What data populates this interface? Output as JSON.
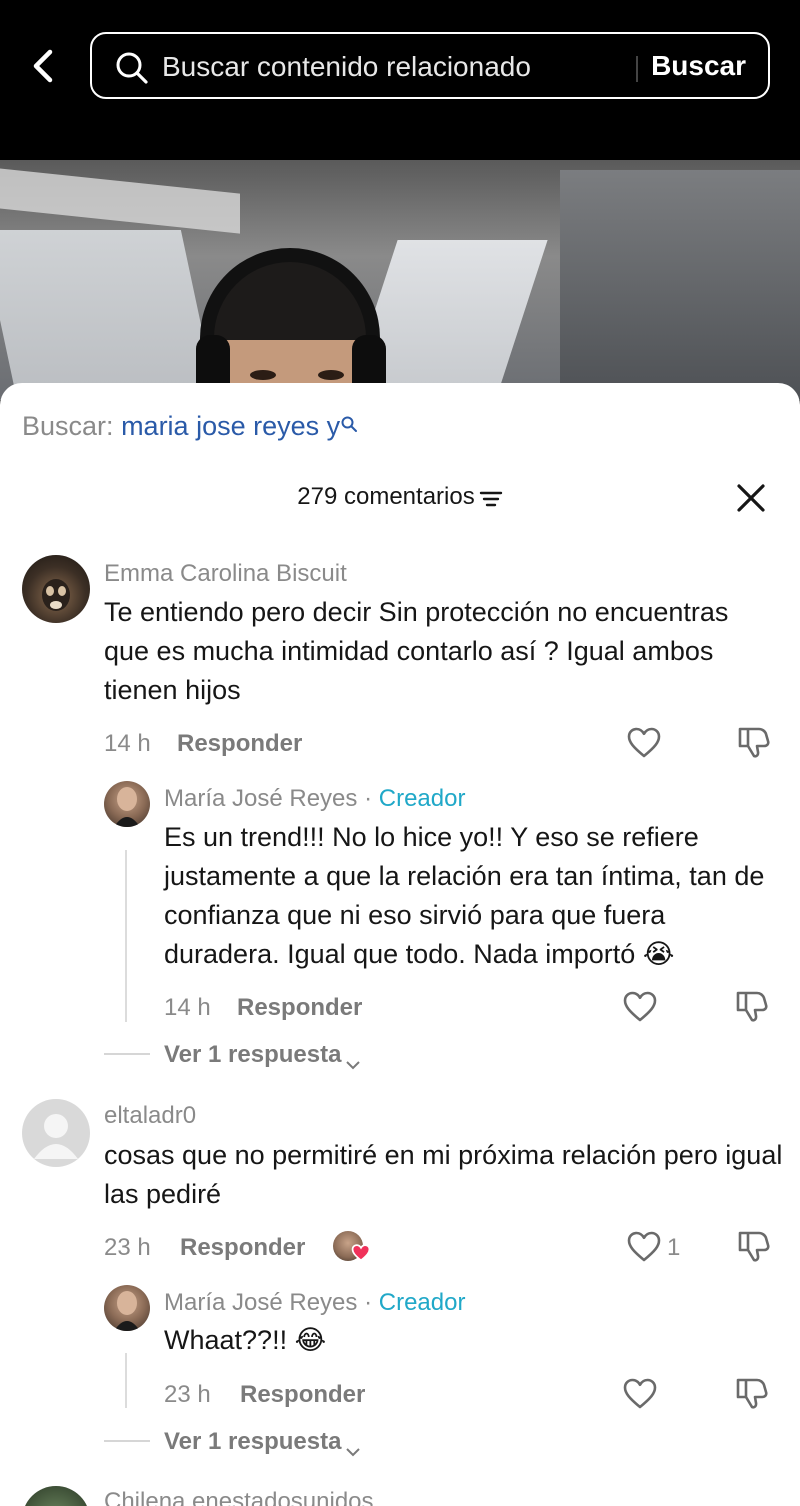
{
  "header": {
    "search_placeholder": "Buscar contenido relacionado",
    "search_button": "Buscar"
  },
  "related_search": {
    "prefix": "Buscar:",
    "term": "maria jose reyes y"
  },
  "comments_header": {
    "count_label": "279 comentarios"
  },
  "comments": [
    {
      "author": "Emma Carolina Biscuit",
      "text": "Te entiendo pero decir Sin protección no encuentras que es mucha intimidad contarlo así ? Igual ambos tienen hijos",
      "time": "14 h",
      "reply_label": "Responder",
      "reply": {
        "author": "María José Reyes",
        "separator": "·",
        "badge": "Creador",
        "text": "Es un trend!!! No lo hice yo!! Y eso se refiere justamente a que la relación era tan íntima, tan de confianza que ni eso sirvió para que fuera duradera. Igual que todo. Nada importó 😭",
        "time": "14 h",
        "reply_label": "Responder"
      },
      "view_replies": "Ver 1 respuesta"
    },
    {
      "author": "eltaladr0",
      "text": "cosas que no permitiré en mi próxima relación pero igual las pediré",
      "time": "23 h",
      "reply_label": "Responder",
      "like_count": "1",
      "reply": {
        "author": "María José Reyes",
        "separator": "·",
        "badge": "Creador",
        "text": "Whaat??!! 😂",
        "time": "23 h",
        "reply_label": "Responder"
      },
      "view_replies": "Ver 1 respuesta"
    },
    {
      "author": "Chilena enestadosunidos"
    }
  ],
  "colors": {
    "creator_badge": "#20a8c8",
    "search_term": "#2a5aa8",
    "creator_heart": "#f0325a"
  },
  "icons": [
    "back-arrow-icon",
    "search-icon",
    "filter-icon",
    "close-icon",
    "heart-icon",
    "dislike-icon",
    "chevron-down-icon"
  ]
}
